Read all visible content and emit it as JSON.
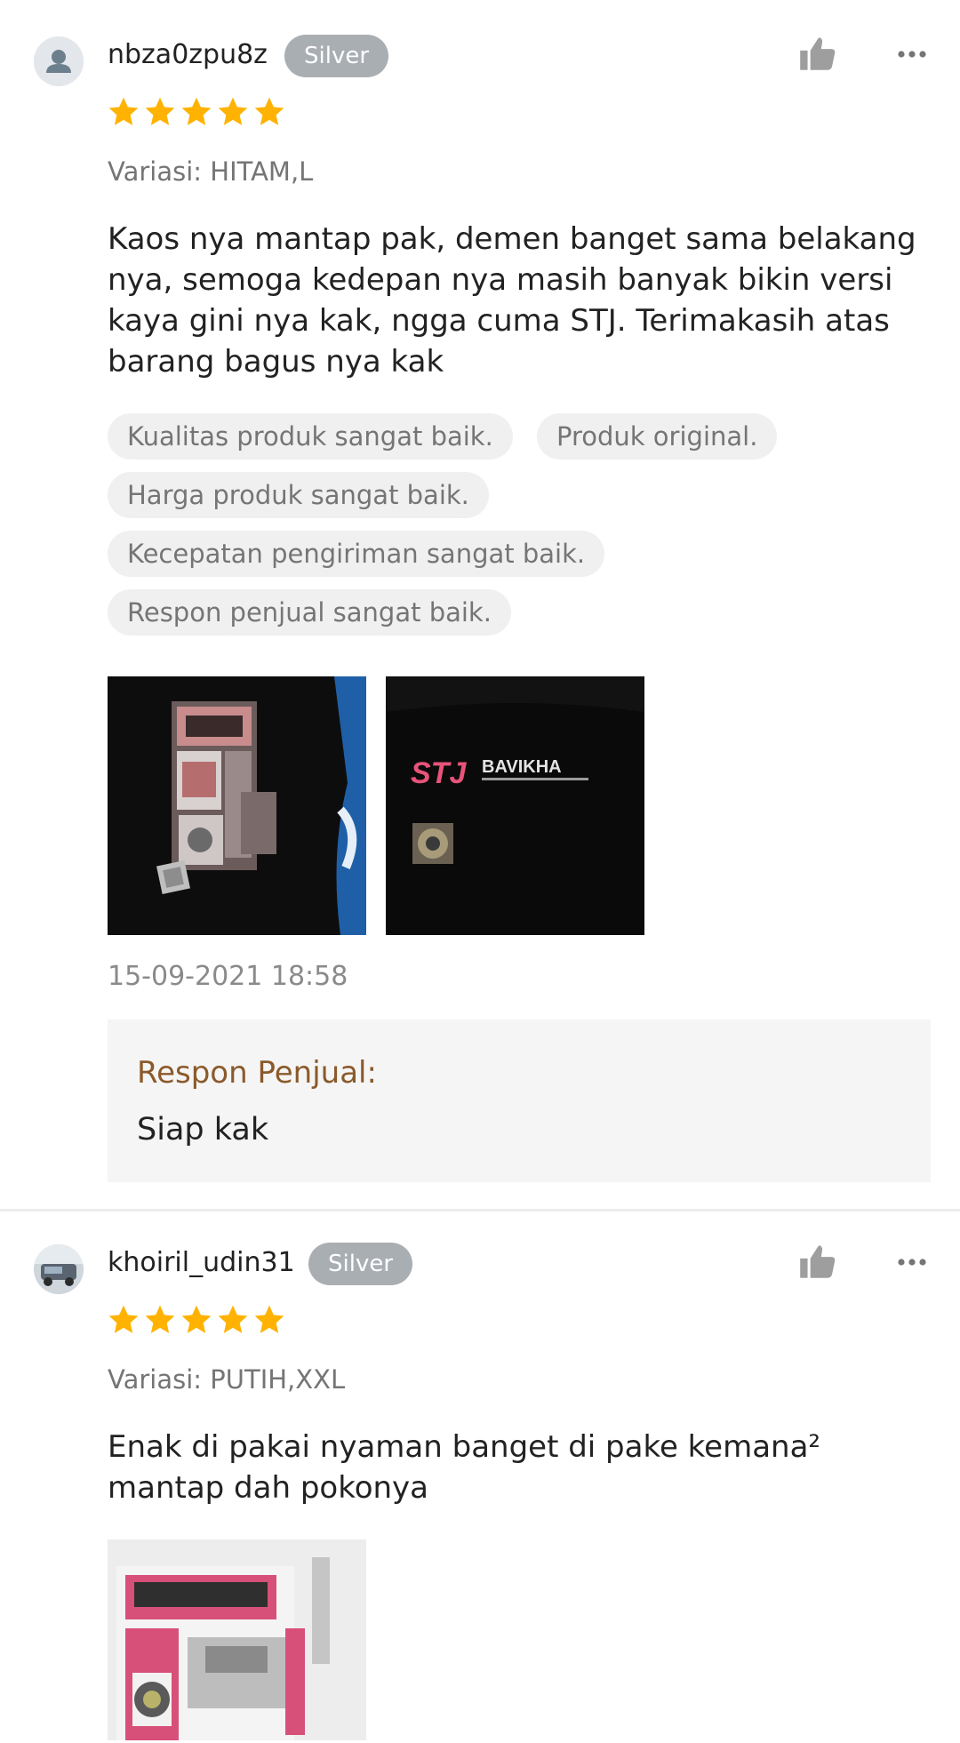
{
  "reviews": [
    {
      "username": "nbza0zpu8z",
      "badge": "Silver",
      "rating": 5,
      "variant": "Variasi: HITAM,L",
      "comment": "Kaos nya mantap pak, demen banget sama belakang nya, semoga kedepan nya masih banyak bikin versi kaya gini nya kak, ngga cuma STJ. Terimakasih atas barang bagus nya kak",
      "tags": [
        "Kualitas produk sangat baik.",
        "Produk original.",
        "Harga produk sangat baik.",
        "Kecepatan pengiriman sangat baik.",
        "Respon penjual sangat baik."
      ],
      "photos": [
        {
          "description": "black t-shirt with printed bus graphic"
        },
        {
          "description": "black t-shirt with STJ BAVIKHA logo",
          "print_text": "STJ BAVIKHA"
        }
      ],
      "timestamp": "15-09-2021 18:58",
      "seller_response": {
        "title": "Respon Penjual:",
        "text": "Siap kak"
      }
    },
    {
      "username": "khoiril_udin31",
      "badge": "Silver",
      "rating": 5,
      "variant": "Variasi: PUTIH,XXL",
      "comment": "Enak di pakai nyaman banget di pake kemana² mantap dah pokonya",
      "photos": [
        {
          "description": "white t-shirt with pink bus graphic"
        }
      ]
    }
  ],
  "colors": {
    "star": "#FFB300",
    "badge": "#A9AEB3",
    "icon_gray": "#9E9E9E",
    "seller_title": "#8B5A2B",
    "tag_bg": "#F0F0F0"
  },
  "icons": {
    "like": "thumbs-up-icon",
    "more": "more-horizontal-icon",
    "avatar_default": "user-silhouette-icon"
  }
}
